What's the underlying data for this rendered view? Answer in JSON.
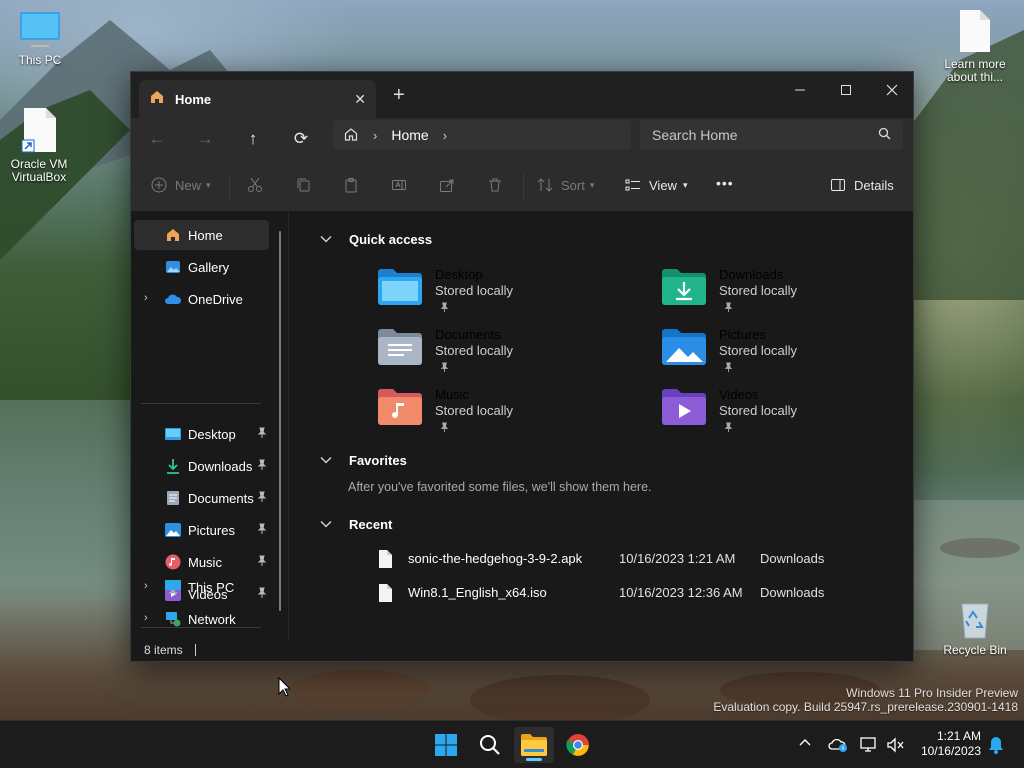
{
  "desktop": {
    "icons": {
      "this_pc": "This PC",
      "oracle_vm": "Oracle VM VirtualBox",
      "learn_more": "Learn more about thi...",
      "recycle_bin": "Recycle Bin"
    },
    "watermark": {
      "line1": "Windows 11 Pro Insider Preview",
      "line2": "Evaluation copy. Build 25947.rs_prerelease.230901-1418"
    }
  },
  "explorer": {
    "tab": {
      "label": "Home",
      "close": "✕"
    },
    "new_tab": "+",
    "window_controls": {
      "minimize": "—",
      "maximize": "☐",
      "close": "✕"
    },
    "nav_buttons": {
      "back": "←",
      "forward": "→",
      "up": "↑",
      "refresh": "⟳"
    },
    "breadcrumb": {
      "current": "Home"
    },
    "search": {
      "placeholder": "Search Home"
    },
    "toolbar": {
      "new_label": "New",
      "sort_label": "Sort",
      "view_label": "View",
      "more_label": "•••",
      "details_label": "Details"
    },
    "nav": {
      "home": "Home",
      "gallery": "Gallery",
      "onedrive": "OneDrive",
      "desktop": "Desktop",
      "downloads": "Downloads",
      "documents": "Documents",
      "pictures": "Pictures",
      "music": "Music",
      "videos": "Videos",
      "this_pc": "This PC",
      "network": "Network"
    },
    "quick_access": {
      "title": "Quick access",
      "items": [
        {
          "name": "Desktop",
          "sub": "Stored locally"
        },
        {
          "name": "Downloads",
          "sub": "Stored locally"
        },
        {
          "name": "Documents",
          "sub": "Stored locally"
        },
        {
          "name": "Pictures",
          "sub": "Stored locally"
        },
        {
          "name": "Music",
          "sub": "Stored locally"
        },
        {
          "name": "Videos",
          "sub": "Stored locally"
        }
      ]
    },
    "favorites": {
      "title": "Favorites",
      "empty": "After you've favorited some files, we'll show them here."
    },
    "recent": {
      "title": "Recent",
      "rows": [
        {
          "name": "sonic-the-hedgehog-3-9-2.apk",
          "date": "10/16/2023 1:21 AM",
          "location": "Downloads"
        },
        {
          "name": "Win8.1_English_x64.iso",
          "date": "10/16/2023 12:36 AM",
          "location": "Downloads"
        }
      ]
    },
    "status": {
      "items": "8 items"
    }
  },
  "taskbar": {
    "time": "1:21 AM",
    "date": "10/16/2023"
  },
  "colors": {
    "accent": "#60cdff",
    "window_bg": "#191919",
    "chrome_bg": "#2c2c2c"
  }
}
